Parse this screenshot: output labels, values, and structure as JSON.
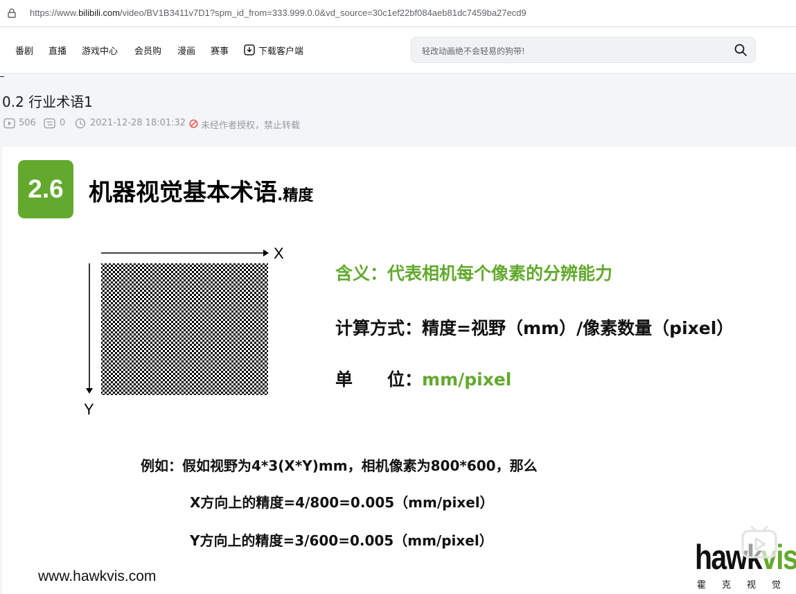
{
  "browser": {
    "url_prefix": "https://www.",
    "url_host": "bilibili.com",
    "url_path": "/video/BV1B3411v7D1?spm_id_from=333.999.0.0&vd_source=30c1ef22bf084aeb81dc7459ba27ecd9"
  },
  "header": {
    "nav": [
      {
        "label": "番剧"
      },
      {
        "label": "直播"
      },
      {
        "label": "游戏中心"
      },
      {
        "label": "会员购"
      },
      {
        "label": "漫画"
      },
      {
        "label": "赛事"
      },
      {
        "label": "下载客户端"
      }
    ],
    "search_placeholder": "轻改动画绝不会轻易的狗带!"
  },
  "video_info": {
    "title": "0.2 行业术语1",
    "views": "506",
    "danmaku": "0",
    "datetime": "2021-12-28 18:01:32",
    "copyright": "未经作者授权，禁止转载"
  },
  "slide": {
    "badge": "2.6",
    "title_main": "机器视觉基本术语",
    "title_sub": ".精度",
    "axis_x": "X",
    "axis_y": "Y",
    "meaning": "含义：代表相机每个像素的分辨能力",
    "calc": "计算方式：精度=视野（mm）/像素数量（pixel）",
    "unit_label": "单　　位：",
    "unit_value": "mm/pixel",
    "example_1": "例如：假如视野为4*3(X*Y)mm，相机像素为800*600，那么",
    "example_2": "X方向上的精度=4/800=0.005（mm/pixel）",
    "example_3": "Y方向上的精度=3/600=0.005（mm/pixel）",
    "website": "www.hawkvis.com",
    "logo_dark": "hawk",
    "logo_green": "vis",
    "logo_sub": "霍克视觉"
  },
  "colors": {
    "accent_green": "#62a92d",
    "warn_red": "#f25d59"
  }
}
